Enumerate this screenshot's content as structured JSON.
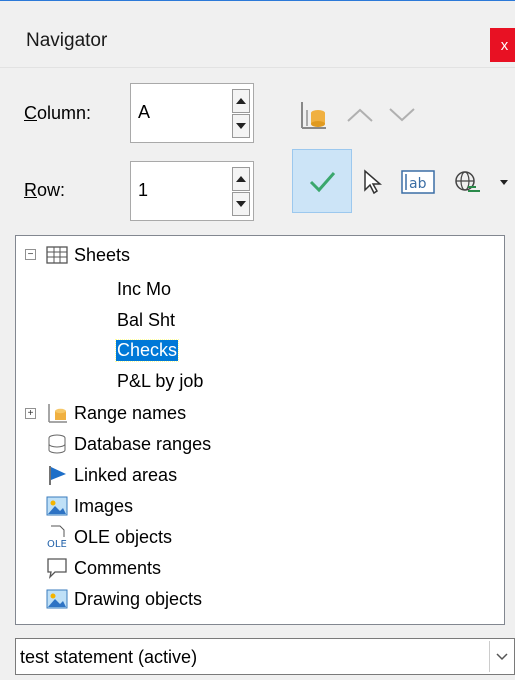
{
  "window": {
    "title": "Navigator",
    "close_glyph": "x"
  },
  "fields": {
    "column_label_u": "C",
    "column_label_rest": "olumn:",
    "column_value": "A",
    "row_label_u": "R",
    "row_label_rest": "ow:",
    "row_value": "1"
  },
  "toolbar": {
    "icons": [
      "data-range-icon",
      "arrow-up-icon",
      "arrow-down-icon",
      "checkmark-icon",
      "pointer-icon",
      "text-box-icon",
      "globe-link-icon",
      "dropdown-arrow-icon"
    ],
    "active": "checkmark-icon"
  },
  "tree": {
    "sheets": {
      "label": "Sheets",
      "children": [
        "Inc Mo",
        "Bal Sht",
        "Checks",
        "P&L by job"
      ],
      "selected": "Checks"
    },
    "items": [
      {
        "label": "Range names",
        "icon": "range-names-icon"
      },
      {
        "label": "Database ranges",
        "icon": "database-icon"
      },
      {
        "label": "Linked areas",
        "icon": "flag-icon"
      },
      {
        "label": "Images",
        "icon": "image-icon"
      },
      {
        "label": "OLE objects",
        "icon": "ole-icon"
      },
      {
        "label": "Comments",
        "icon": "comment-icon"
      },
      {
        "label": "Drawing objects",
        "icon": "drawing-icon"
      }
    ]
  },
  "document_selector": {
    "value": "test statement (active)"
  },
  "colors": {
    "accent": "#0078d7",
    "close": "#e81123",
    "check": "#3aa76d",
    "active_bg": "#cce4f7"
  }
}
